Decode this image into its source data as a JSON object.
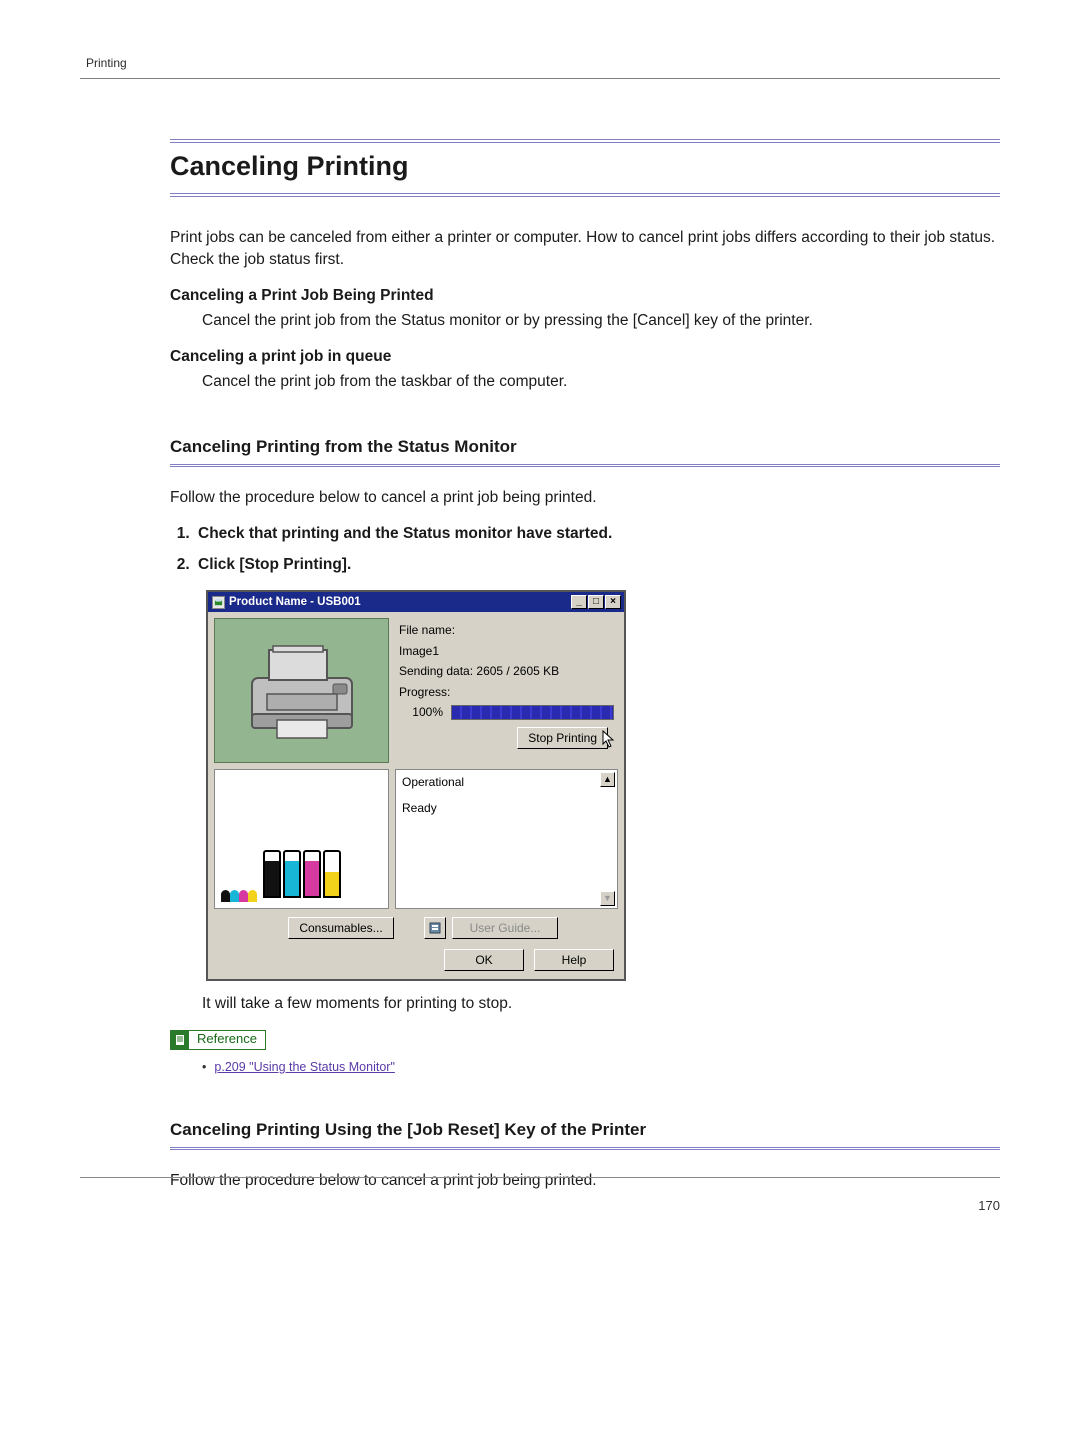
{
  "running_head": "Printing",
  "page_number": "170",
  "h1": "Canceling Printing",
  "intro": "Print jobs can be canceled from either a printer or computer. How to cancel print jobs differs according to their job status. Check the job status first.",
  "sub1_label": "Canceling a Print Job Being Printed",
  "sub1_body": "Cancel the print job from the Status monitor or by pressing the [Cancel] key of the printer.",
  "sub2_label": "Canceling a print job in queue",
  "sub2_body": "Cancel the print job from the taskbar of the computer.",
  "h2a": "Canceling Printing from the Status Monitor",
  "h2a_lead": "Follow the procedure below to cancel a print job being printed.",
  "steps": {
    "s1": "Check that printing and the Status monitor have started.",
    "s2": "Click [Stop Printing]."
  },
  "dialog": {
    "title": "Product Name  - USB001",
    "file_name_label": "File name:",
    "file_name_value": "Image1",
    "sending": "Sending data: 2605 / 2605 KB",
    "progress_label": "Progress:",
    "progress_value": "100%",
    "stop_btn": "Stop Printing",
    "status1": "Operational",
    "status2": "Ready",
    "consumables_btn": "Consumables...",
    "user_guide_btn": "User Guide...",
    "ok_btn": "OK",
    "help_btn": "Help"
  },
  "after_dialog": "It will take a few moments for printing to stop.",
  "reference_label": "Reference",
  "reference_link": "p.209 \"Using the Status Monitor\"",
  "h2b": "Canceling Printing Using the [Job Reset] Key of the Printer",
  "h2b_lead": "Follow the procedure below to cancel a print job being printed."
}
